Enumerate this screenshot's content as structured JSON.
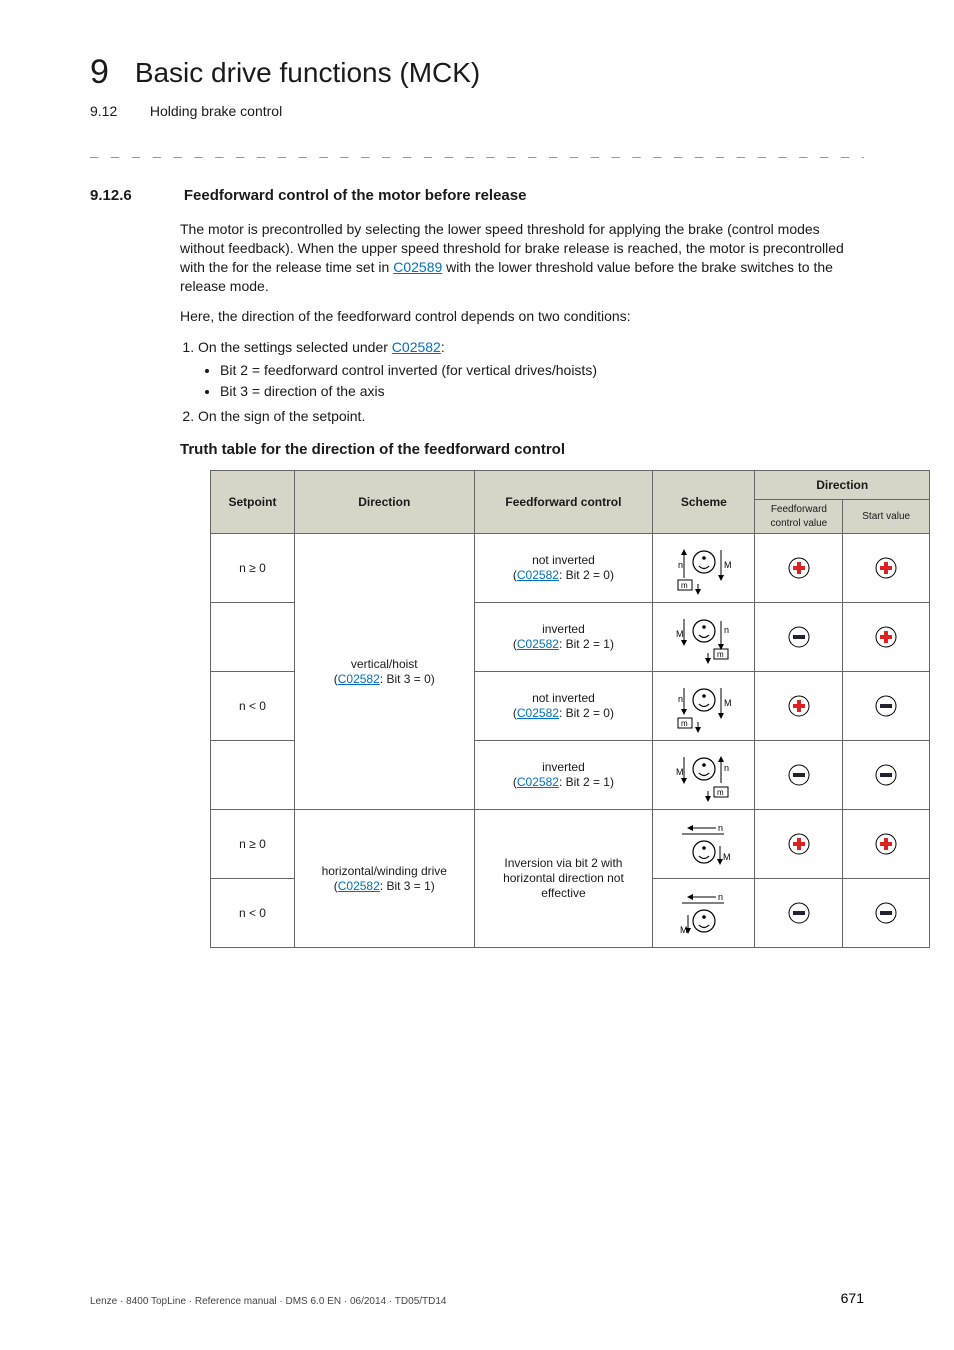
{
  "chapter": {
    "number": "9",
    "title": "Basic drive functions (MCK)"
  },
  "section": {
    "number": "9.12",
    "title": "Holding brake control"
  },
  "subsection": {
    "number": "9.12.6",
    "title": "Feedforward control of the motor before release"
  },
  "para1_a": "The motor is precontrolled by selecting the lower speed threshold for applying the brake (control modes without feedback). When the upper speed threshold for brake release is reached, the motor is precontrolled with the for the release time set in ",
  "para1_link": "C02589",
  "para1_b": " with the lower threshold value before the brake switches to the release mode.",
  "para2": "Here, the direction of the feedforward control depends on two conditions:",
  "list": {
    "item1_a": "On the settings selected under ",
    "item1_link": "C02582",
    "item1_b": ":",
    "sub1": "Bit 2 = feedforward control inverted (for vertical drives/hoists)",
    "sub2": "Bit 3 = direction of the axis",
    "item2": "On the sign of the setpoint."
  },
  "truth_heading": "Truth table for the direction of the feedforward control",
  "thead": {
    "c1": "Setpoint",
    "c2": "Direction",
    "c3": "Feedforward control",
    "c4": "Scheme",
    "c5": "Direction",
    "c5a": "Feedforward control value",
    "c5b": "Start value"
  },
  "rows": [
    {
      "setpoint": "n ≥ 0",
      "dir_a": "vertical/hoist",
      "dir_link": "C02582",
      "dir_b": ": Bit 3 = 0)",
      "ff_a": "not inverted",
      "ff_link": "C02582",
      "ff_b": ": Bit 2 = 0)",
      "scheme": "vh1",
      "d1": "plus",
      "d2": "plus"
    },
    {
      "ff_a": "inverted",
      "ff_link": "C02582",
      "ff_b": ": Bit 2 = 1)",
      "scheme": "vh2",
      "d1": "minus",
      "d2": "plus"
    },
    {
      "setpoint": "n < 0",
      "ff_a": "not inverted",
      "ff_link": "C02582",
      "ff_b": ": Bit 2 = 0)",
      "scheme": "vh3",
      "d1": "plus",
      "d2": "minus"
    },
    {
      "ff_a": "inverted",
      "ff_link": "C02582",
      "ff_b": ": Bit 2 = 1)",
      "scheme": "vh4",
      "d1": "minus",
      "d2": "minus"
    },
    {
      "setpoint": "n ≥ 0",
      "dir_a": "horizontal/winding drive",
      "dir_link": "C02582",
      "dir_b": ": Bit 3 = 1)",
      "ff_a": "Inversion via bit 2 with horizontal direction not effective",
      "scheme": "hz1",
      "d1": "plus",
      "d2": "plus"
    },
    {
      "setpoint": "n < 0",
      "scheme": "hz2",
      "d1": "minus",
      "d2": "minus"
    }
  ],
  "footer": {
    "text": "Lenze · 8400 TopLine · Reference manual · DMS 6.0 EN · 06/2014 · TD05/TD14",
    "page": "671"
  }
}
